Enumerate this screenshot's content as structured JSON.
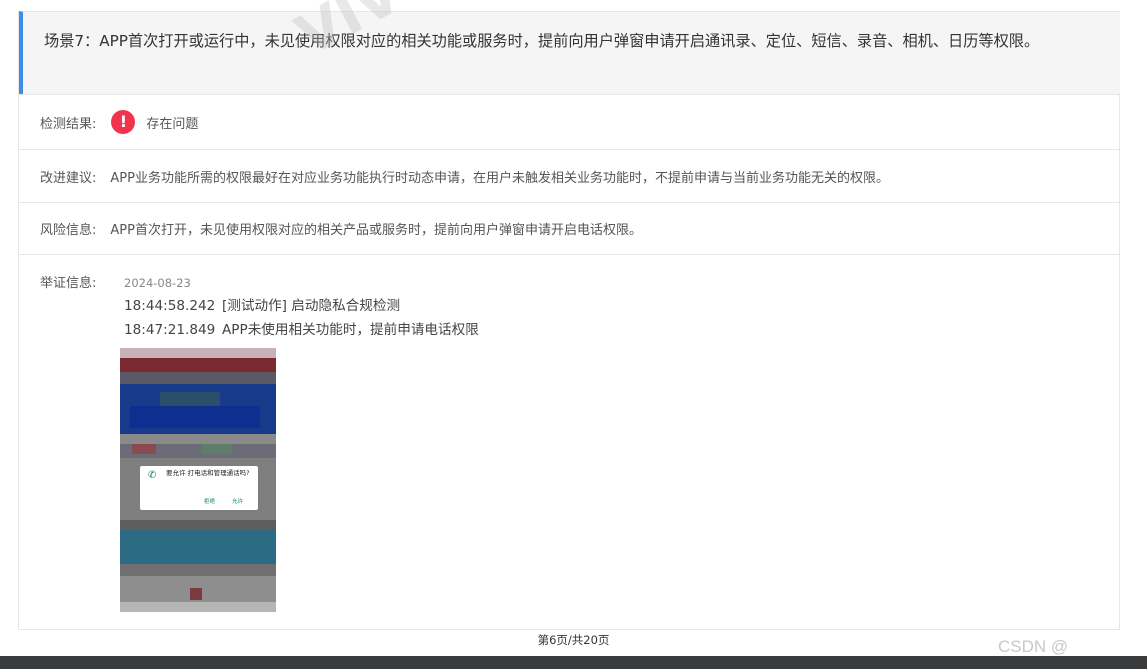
{
  "scene": {
    "title": "场景7：APP首次打开或运行中，未见使用权限对应的相关功能或服务时，提前向用户弹窗申请开启通讯录、定位、短信、录音、相机、日历等权限。"
  },
  "result": {
    "label": "检测结果:",
    "icon": "exclamation-icon",
    "status": "存在问题",
    "status_color": "#f0344e"
  },
  "suggestion": {
    "label": "改进建议:",
    "text": "APP业务功能所需的权限最好在对应业务功能执行时动态申请，在用户未触发相关业务功能时，不提前申请与当前业务功能无关的权限。"
  },
  "risk": {
    "label": "风险信息:",
    "text": "APP首次打开，未见使用权限对应的相关产品或服务时，提前向用户弹窗申请开启电话权限。"
  },
  "evidence": {
    "label": "举证信息:",
    "date": "2024-08-23",
    "entries": [
      {
        "time": "18:44:58.242",
        "text": "[测试动作] 启动隐私合规检测"
      },
      {
        "time": "18:47:21.849",
        "text": "APP未使用相关功能时，提前申请电话权限"
      }
    ],
    "screenshot": {
      "dialog_title": "要允许 打电话和管理通话吗?",
      "deny": "拒绝",
      "allow": "允许"
    }
  },
  "pager": {
    "text": "第6页/共20页"
  },
  "watermark": {
    "text": "VIVO隐"
  },
  "footer_brand": {
    "text": "CSDN @"
  },
  "colors": {
    "accent": "#3d8ee8",
    "danger": "#f0344e",
    "header_bg": "#f5f5f5"
  }
}
